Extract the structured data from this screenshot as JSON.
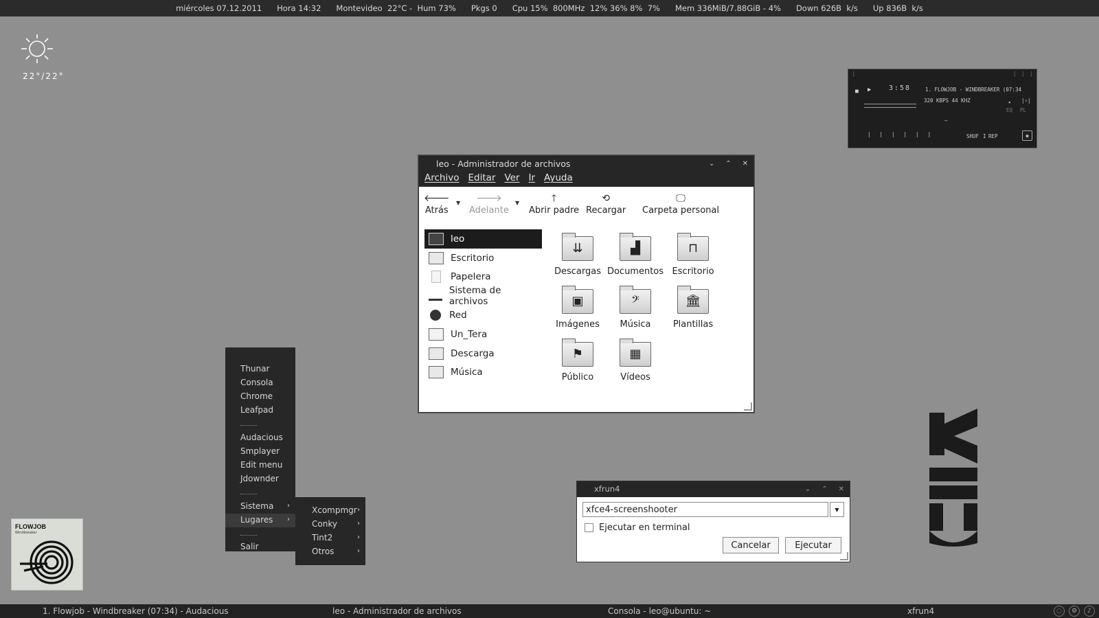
{
  "topbar": {
    "date": "miércoles 07.12.2011",
    "time": "Hora 14:32",
    "weather": "Montevideo  22°C -  Hum 73%",
    "pkgs": "Pkgs 0",
    "cpu": "Cpu 15%  800MHz  12% 36% 8%  7%",
    "mem": "Mem 336MiB/7.88GiB - 4%",
    "down": "Down 626B  k/s",
    "up": "Up 836B  k/s"
  },
  "weather_widget": {
    "temp": "22°/22°",
    "icon": "sun-icon"
  },
  "player": {
    "time": "3:58",
    "track": "1. FLOWJOB - WINDBREAKER (07:34",
    "info": "320 KBPS 44 KHZ",
    "shuf": "SHUF",
    "rep": "REP",
    "eq": "EQ",
    "pl": "PL"
  },
  "file_manager": {
    "title": "leo - Administrador de archivos",
    "menu": [
      "Archivo",
      "Editar",
      "Ver",
      "Ir",
      "Ayuda"
    ],
    "toolbar": {
      "back": "Atrás",
      "forward": "Adelante",
      "up": "Abrir padre",
      "reload": "Recargar",
      "home": "Carpeta personal"
    },
    "sidebar": [
      {
        "label": "leo",
        "icon": "computer-icon"
      },
      {
        "label": "Escritorio",
        "icon": "desktop-folder-icon"
      },
      {
        "label": "Papelera",
        "icon": "trash-icon"
      },
      {
        "label": "Sistema de archivos",
        "icon": "drive-icon"
      },
      {
        "label": "Red",
        "icon": "network-icon"
      },
      {
        "label": "Un_Tera",
        "icon": "folder-icon"
      },
      {
        "label": "Descarga",
        "icon": "download-folder-icon"
      },
      {
        "label": "Música",
        "icon": "music-folder-icon"
      }
    ],
    "folders": [
      {
        "label": "Descargas",
        "icon": "download-folder-icon"
      },
      {
        "label": "Documentos",
        "icon": "documents-folder-icon"
      },
      {
        "label": "Escritorio",
        "icon": "desktop-folder-icon"
      },
      {
        "label": "Imágenes",
        "icon": "pictures-folder-icon"
      },
      {
        "label": "Música",
        "icon": "music-folder-icon"
      },
      {
        "label": "Plantillas",
        "icon": "templates-folder-icon"
      },
      {
        "label": "Público",
        "icon": "public-folder-icon"
      },
      {
        "label": "Vídeos",
        "icon": "videos-folder-icon"
      }
    ]
  },
  "root_menu": {
    "items": [
      "Thunar",
      "Consola",
      "Chrome",
      "Leafpad",
      "Audacious",
      "Smplayer",
      "Edit menu",
      "Jdownder",
      "Sistema",
      "Lugares",
      "Salir"
    ]
  },
  "submenu": {
    "items": [
      "Xcompmgr",
      "Conky",
      "Tint2",
      "Otros"
    ]
  },
  "album": {
    "artist": "FLOWJOB",
    "album": "Windbreaker"
  },
  "xfrun": {
    "title": "xfrun4",
    "command": "xfce4-screenshooter",
    "checkbox": "Ejecutar en terminal",
    "cancel": "Cancelar",
    "run": "Ejecutar"
  },
  "taskbar": {
    "tasks": [
      "1. Flowjob - Windbreaker (07:34) - Audacious",
      "leo - Administrador de archivos",
      "Consola - leo@ubuntu: ~",
      "xfrun4"
    ]
  }
}
